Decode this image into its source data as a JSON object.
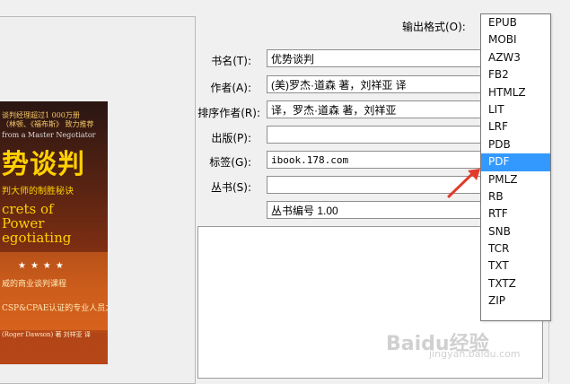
{
  "output_format": {
    "label": "输出格式(O):",
    "options": [
      "EPUB",
      "MOBI",
      "AZW3",
      "FB2",
      "HTMLZ",
      "LIT",
      "LRF",
      "PDB",
      "PDF",
      "PMLZ",
      "RB",
      "RTF",
      "SNB",
      "TCR",
      "TXT",
      "TXTZ",
      "ZIP"
    ],
    "selected": "PDF"
  },
  "metadata": {
    "title_label": "书名(T):",
    "title_value": "优势谈判",
    "author_label": "作者(A):",
    "author_value": "(美)罗杰·道森 著，刘祥亚 译",
    "sort_author_label": "排序作者(R):",
    "sort_author_value": "译，罗杰·道森 著，刘祥亚",
    "publisher_label": "出版(P):",
    "publisher_value": "",
    "tags_label": "标签(G):",
    "tags_value": "ibook.178.com",
    "series_label": "丛书(S):",
    "series_value": "",
    "series_index_value": "丛书编号 1.00"
  },
  "cover": {
    "line1": "谈判经理超过1 000万册",
    "line2": "（林顿、《福布斯》 致力推荐",
    "line3": "from a Master Negotiator",
    "line4": "势谈判",
    "line5": "判大师的制胜秘诀",
    "line6a": "crets of",
    "line6b": "Power",
    "line6c": "egotiating",
    "stars": "★★★★",
    "line7": "威的商业谈判课程",
    "line8": "CSP&CPAE认证的专业人员之一",
    "line9": "(Roger Dawson)  著    刘祥亚  译"
  },
  "colors": {
    "selection": "#3399ff",
    "arrow": "#e23a2c"
  },
  "watermark": {
    "brand": "Baidu经验",
    "url": "jingyan.baidu.com"
  }
}
